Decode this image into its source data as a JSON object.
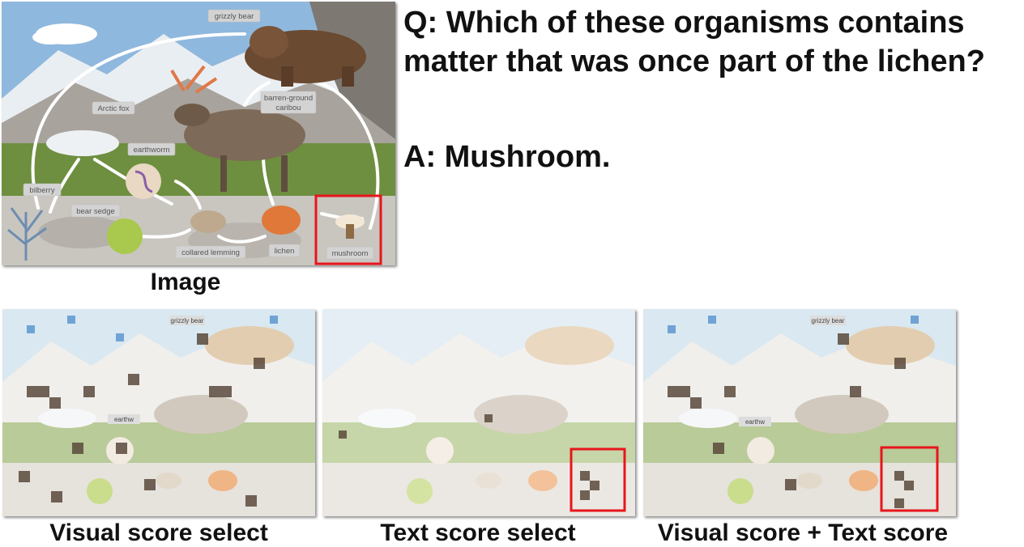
{
  "question": "Q: Which of these organisms contains matter that was once part of the lichen?",
  "answer": "A: Mushroom.",
  "image_caption": "Image",
  "panels": [
    {
      "caption": "Visual score select",
      "highlight": false
    },
    {
      "caption": "Text score select",
      "highlight": true
    },
    {
      "caption": "Visual score + Text score",
      "highlight": true
    }
  ],
  "organism_labels": {
    "grizzly_bear": "grizzly bear",
    "arctic_fox": "Arctic fox",
    "barren_ground_caribou_line1": "barren-ground",
    "barren_ground_caribou_line2": "caribou",
    "earthworm": "earthworm",
    "bilberry": "bilberry",
    "bear_sedge": "bear sedge",
    "collared_lemming": "collared lemming",
    "lichen": "lichen",
    "mushroom": "mushroom"
  },
  "thumb_labels": {
    "grizzly_bear": "grizzly bear",
    "earthworm": "earthw"
  },
  "colors": {
    "highlight_box": "#e8151b",
    "sky": "#8fb8de",
    "grass": "#6e8f3f",
    "arrow": "#ffffff"
  }
}
